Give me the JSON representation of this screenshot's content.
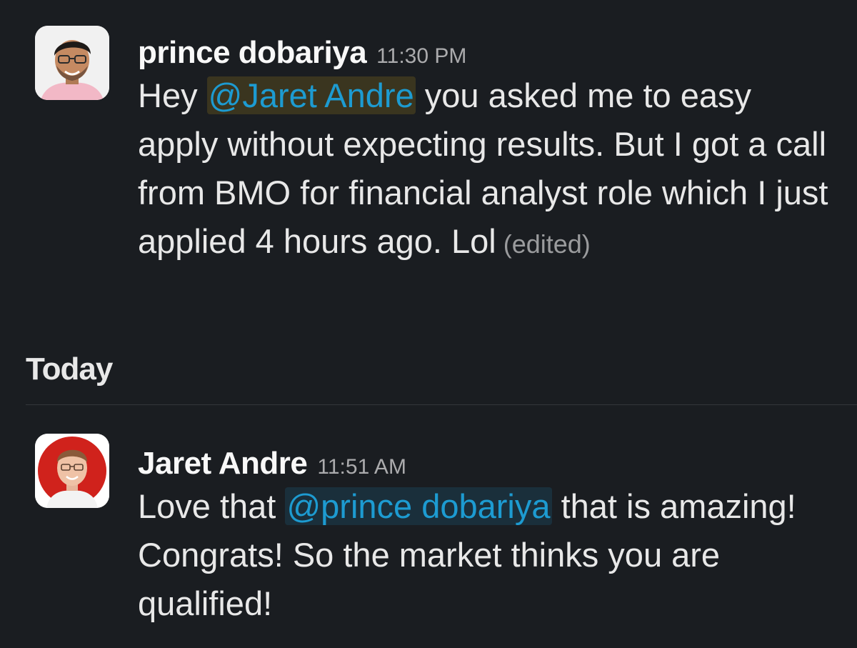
{
  "messages": [
    {
      "author": "prince dobariya",
      "timestamp": "11:30 PM",
      "text_before": "Hey ",
      "mention": "@Jaret Andre",
      "text_after": " you asked me to easy apply without expecting results. But I got a call from BMO for financial analyst role which I just applied 4 hours ago. Lol",
      "edited_label": "(edited)",
      "avatar_bg": "#f4f4f4"
    },
    {
      "author": "Jaret Andre",
      "timestamp": "11:51 AM",
      "text_before": "Love that ",
      "mention": "@prince dobariya",
      "text_after": " that is amazing! Congrats! So the market thinks you are qualified!",
      "avatar_bg": "#d32f2f"
    }
  ],
  "day_divider": {
    "label": "Today"
  },
  "colors": {
    "background": "#1a1d21",
    "mention": "#1d9bd1",
    "text": "#e8e8e8",
    "muted": "#ababad"
  }
}
